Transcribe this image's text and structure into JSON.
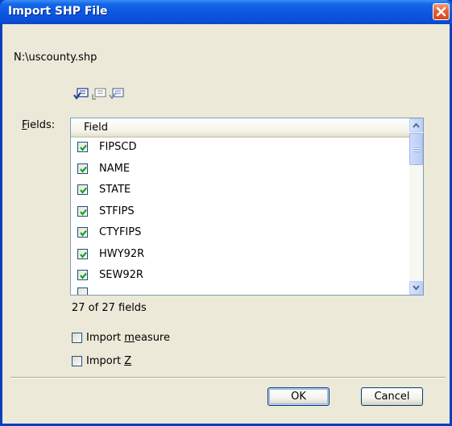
{
  "window": {
    "title": "Import SHP File",
    "colors": {
      "titlebar": "#0a55df",
      "close": "#d9471c",
      "face": "#ece9d8"
    }
  },
  "file_path": "N:\\uscounty.shp",
  "toolbar": {
    "icons": [
      "check-all-icon",
      "uncheck-all-icon",
      "toggle-checks-icon"
    ]
  },
  "fields": {
    "label_prefix": "F",
    "label_rest": "ields:",
    "column_header": "Field",
    "items": [
      {
        "name": "FIPSCD",
        "checked": true
      },
      {
        "name": "NAME",
        "checked": true
      },
      {
        "name": "STATE",
        "checked": true
      },
      {
        "name": "STFIPS",
        "checked": true
      },
      {
        "name": "CTYFIPS",
        "checked": true
      },
      {
        "name": "HWY92R",
        "checked": true
      },
      {
        "name": "SEW92R",
        "checked": true
      }
    ],
    "count_text": "27 of 27 fields"
  },
  "options": {
    "import_measure": {
      "pre": "Import ",
      "accel": "m",
      "post": "easure",
      "checked": false
    },
    "import_z": {
      "pre": "Import ",
      "accel": "Z",
      "post": "",
      "checked": false
    }
  },
  "buttons": {
    "ok": "OK",
    "cancel": "Cancel"
  }
}
